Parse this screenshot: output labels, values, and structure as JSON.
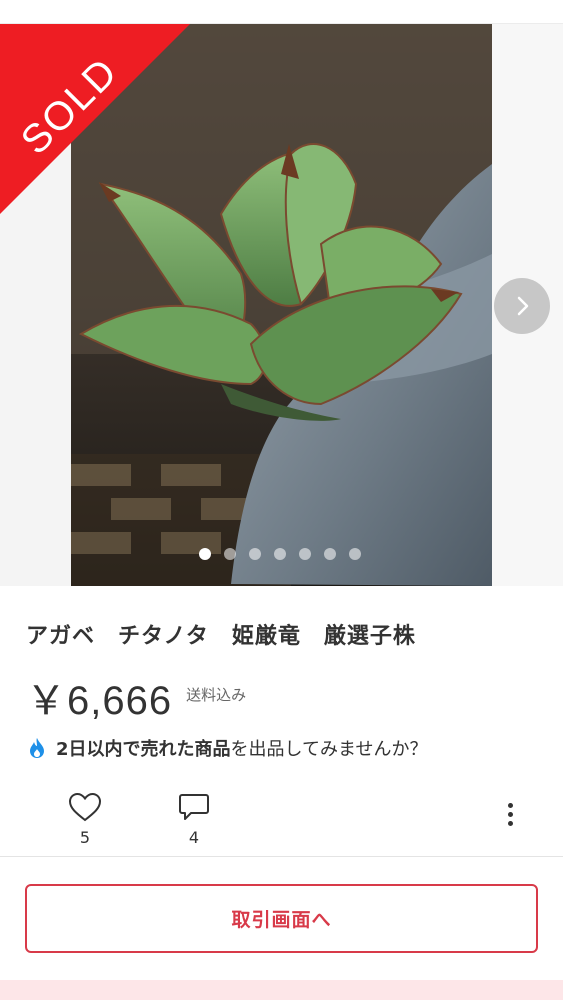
{
  "gallery": {
    "sold_label": "SOLD",
    "dots_total": 7,
    "active_dot": 0,
    "next_icon": "chevron-right-icon"
  },
  "item": {
    "title": "アガベ　チタノタ　姫厳竜　厳選子株",
    "price": "￥6,666",
    "shipping": "送料込み"
  },
  "promo": {
    "icon": "flame-icon",
    "bold_text": "2日以内で売れた商品",
    "rest_text": "を出品してみませんか？"
  },
  "actions": {
    "likes": "5",
    "comments": "4"
  },
  "cta": {
    "label": "取引画面へ"
  },
  "colors": {
    "accent": "#d83a49",
    "sold_ribbon": "#ee1d23",
    "promo_flame": "#1e90e8"
  }
}
